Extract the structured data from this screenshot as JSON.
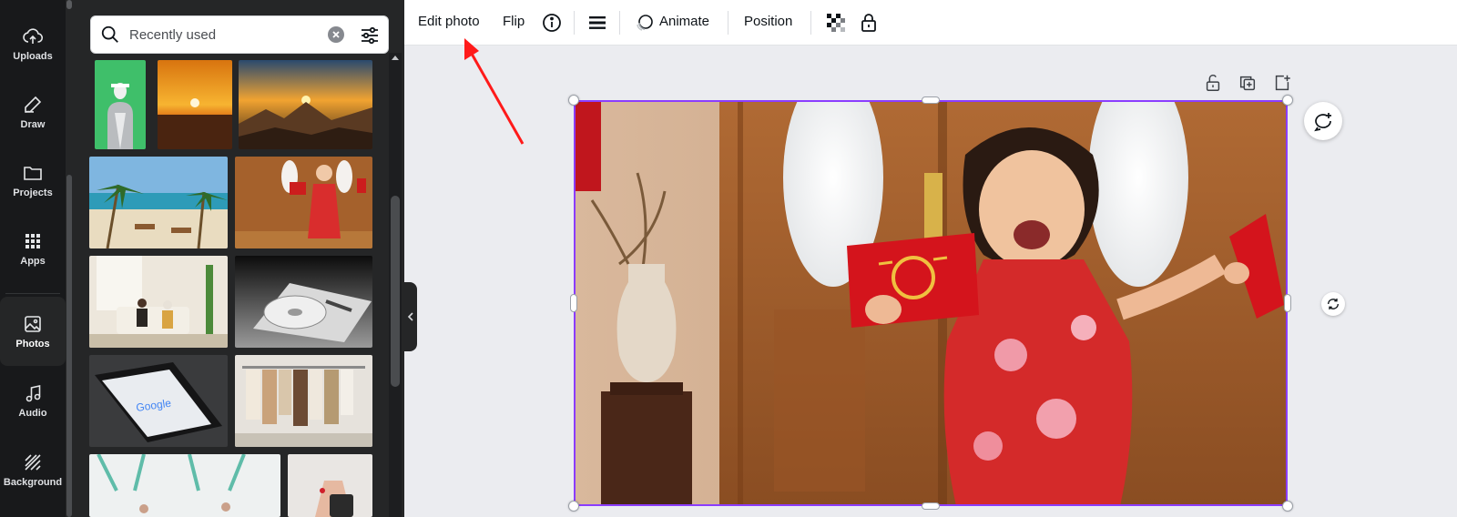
{
  "sidebar": {
    "items": [
      {
        "label": "Uploads",
        "icon": "cloud-upload-icon"
      },
      {
        "label": "Draw",
        "icon": "pen-icon"
      },
      {
        "label": "Projects",
        "icon": "folder-icon"
      },
      {
        "label": "Apps",
        "icon": "grid-icon"
      },
      {
        "label": "Photos",
        "icon": "image-icon",
        "active": true
      },
      {
        "label": "Audio",
        "icon": "music-note-icon"
      },
      {
        "label": "Background",
        "icon": "stripes-icon"
      }
    ]
  },
  "panel": {
    "search": {
      "placeholder": "Recently used",
      "value": ""
    }
  },
  "toolbar": {
    "edit_photo": "Edit photo",
    "flip": "Flip",
    "animate": "Animate",
    "position": "Position"
  },
  "colors": {
    "accent": "#8b3dff",
    "rail_bg": "#18191b",
    "panel_bg": "#252627",
    "canvas_bg": "#ebecf0",
    "annotation_arrow": "#ff1a1a"
  }
}
